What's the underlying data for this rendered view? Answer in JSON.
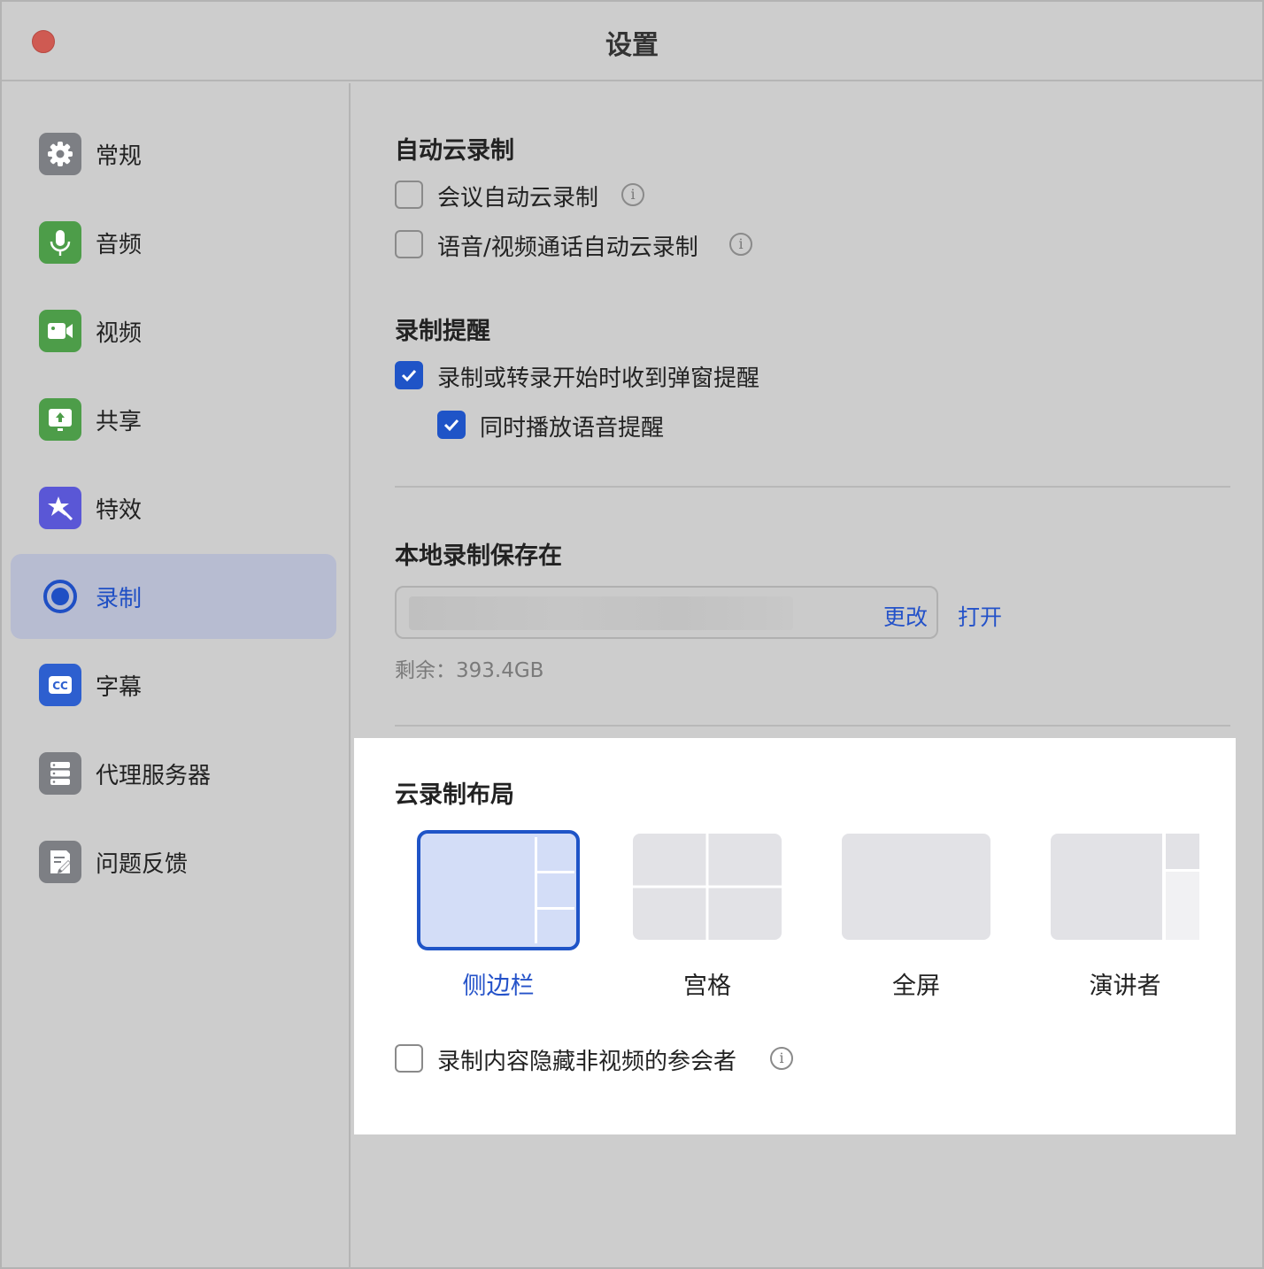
{
  "window": {
    "title": "设置"
  },
  "sidebar": {
    "items": [
      {
        "label": "常规",
        "icon": "gear-icon",
        "color": "#7d7f84"
      },
      {
        "label": "音频",
        "icon": "microphone-icon",
        "color": "#4d9d49"
      },
      {
        "label": "视频",
        "icon": "video-camera-icon",
        "color": "#4d9d49"
      },
      {
        "label": "共享",
        "icon": "share-screen-icon",
        "color": "#4d9d49"
      },
      {
        "label": "特效",
        "icon": "effects-icon",
        "color": "#5a57d6"
      },
      {
        "label": "录制",
        "icon": "record-icon",
        "color": "#1f4fc4",
        "active": true
      },
      {
        "label": "字幕",
        "icon": "captions-icon",
        "color": "#2d5fcf"
      },
      {
        "label": "代理服务器",
        "icon": "server-icon",
        "color": "#7d7f84"
      },
      {
        "label": "问题反馈",
        "icon": "feedback-icon",
        "color": "#7d7f84"
      }
    ]
  },
  "auto_cloud": {
    "title": "自动云录制",
    "meeting_label": "会议自动云录制",
    "meeting_checked": false,
    "call_label": "语音/视频通话自动云录制",
    "call_checked": false
  },
  "reminder": {
    "title": "录制提醒",
    "popup_label": "录制或转录开始时收到弹窗提醒",
    "popup_checked": true,
    "voice_label": "同时播放语音提醒",
    "voice_checked": true
  },
  "local": {
    "title": "本地录制保存在",
    "change_label": "更改",
    "open_label": "打开",
    "remaining": "剩余：393.4GB"
  },
  "cloud_layout": {
    "title": "云录制布局",
    "options": [
      {
        "label": "侧边栏",
        "selected": true
      },
      {
        "label": "宫格",
        "selected": false
      },
      {
        "label": "全屏",
        "selected": false
      },
      {
        "label": "演讲者",
        "selected": false
      }
    ],
    "hide_label": "录制内容隐藏非视频的参会者",
    "hide_checked": false
  },
  "colors": {
    "accent": "#1f54c7",
    "link": "#2452c9",
    "selected_thumb": "#d3ddf7",
    "thumb": "#e2e2e6"
  }
}
